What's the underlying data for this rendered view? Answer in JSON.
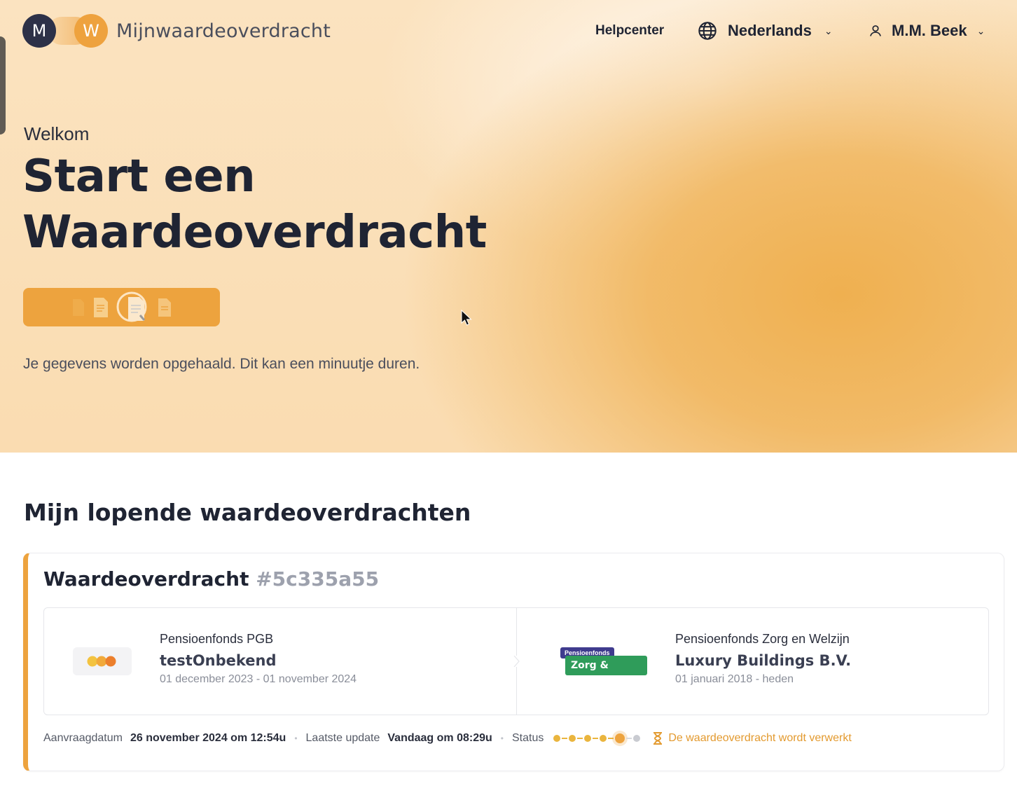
{
  "brand": {
    "mark_left": "M",
    "mark_right": "W",
    "name": "Mijnwaardeoverdracht"
  },
  "nav": {
    "help": "Helpcenter",
    "language": "Nederlands",
    "user": "M.M. Beek"
  },
  "hero": {
    "welcome": "Welkom",
    "title": "Start een Waardeoverdracht",
    "loading_text": "Je gegevens worden opgehaald. Dit kan een minuutje duren."
  },
  "section": {
    "title": "Mijn lopende waardeoverdrachten"
  },
  "transfer": {
    "title": "Waardeoverdracht",
    "id": "#5c335a55",
    "from": {
      "fund": "Pensioenfonds PGB",
      "employer": "testOnbekend",
      "period": "01 december 2023 - 01 november 2024"
    },
    "to": {
      "fund": "Pensioenfonds Zorg en Welzijn",
      "logo_top": "Pensioenfonds",
      "logo_main": "Zorg & Welzijn",
      "employer": "Luxury Buildings B.V.",
      "period": "01 januari 2018 - heden"
    },
    "meta": {
      "request_label": "Aanvraagdatum",
      "request_value": "26 november 2024 om 12:54u",
      "update_label": "Laatste update",
      "update_value": "Vandaag om 08:29u",
      "status_label": "Status",
      "status_steps_total": 6,
      "status_current_step": 5,
      "status_text": "De waardeoverdracht wordt verwerkt"
    }
  },
  "colors": {
    "accent": "#eda33e",
    "dark": "#1f2433",
    "status_text": "#e39a2f"
  }
}
